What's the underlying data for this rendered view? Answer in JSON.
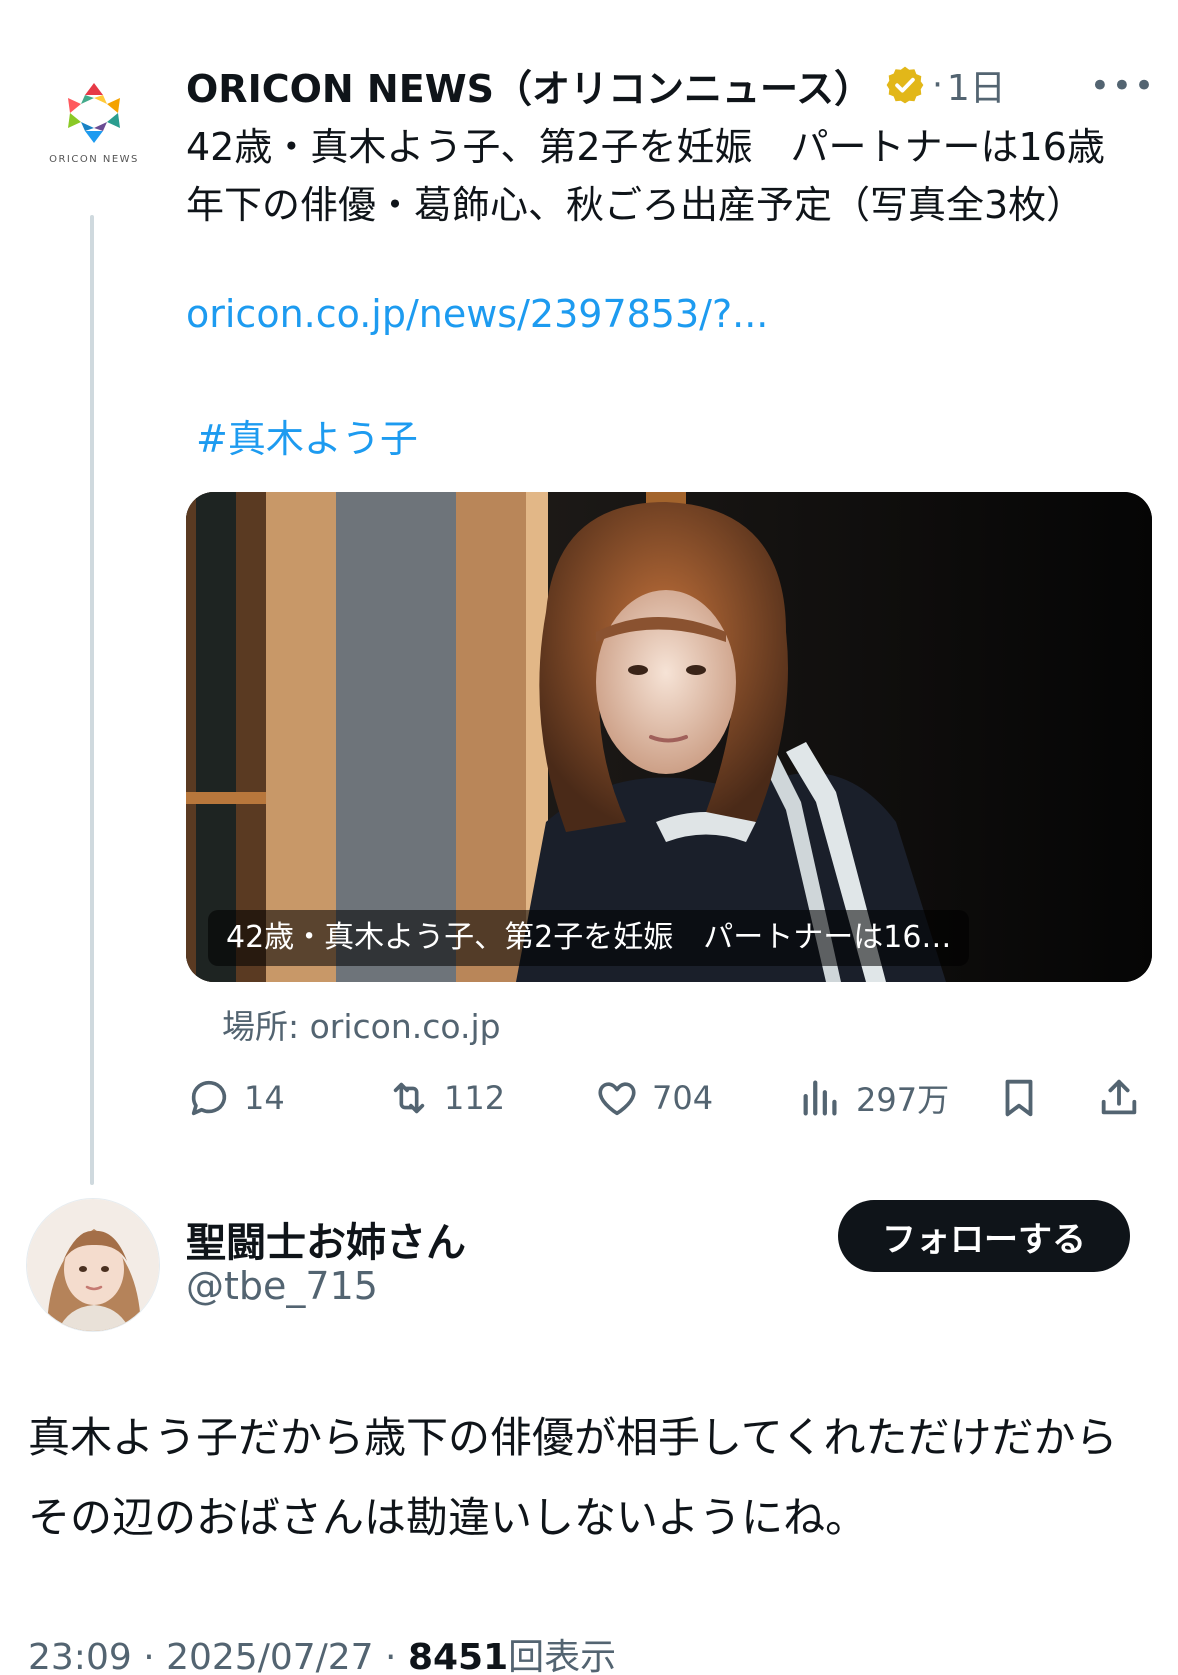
{
  "parent_tweet": {
    "avatar_caption": "ORICON NEWS",
    "display_name": "ORICON NEWS（オリコンニュース）",
    "time_ago": "1日",
    "text": "42歳・真木よう子、第2子を妊娠　パートナーは16歳年下の俳優・葛飾心、秋ごろ出産予定（写真全3枚）",
    "link": "oricon.co.jp/news/2397853/?...",
    "hashtag": "#真木よう子",
    "card": {
      "caption": "42歳・真木よう子、第2子を妊娠　パートナーは16…",
      "source": "場所: oricon.co.jp"
    },
    "actions": {
      "replies": "14",
      "retweets": "112",
      "likes": "704",
      "views": "297万"
    }
  },
  "reply_tweet": {
    "display_name": "聖闘士お姉さん",
    "handle": "@tbe_715",
    "follow_label": "フォローする",
    "text": "真木よう子だから歳下の俳優が相手してくれただけだからその辺のおばさんは勘違いしないようにね。",
    "time": "23:09",
    "date": "2025/07/27",
    "views_count": "8451",
    "views_label": "回表示"
  },
  "colors": {
    "link": "#1d9bf0",
    "secondary_text": "#536471",
    "primary_text": "#0f1419",
    "verified_badge": "#e2b719",
    "follow_button": "#0f1419"
  },
  "icons": {
    "verified": "verified-badge-icon",
    "more": "more-dots-icon",
    "reply": "reply-bubble-icon",
    "retweet": "retweet-arrows-icon",
    "like": "heart-icon",
    "views": "bar-chart-icon",
    "bookmark": "bookmark-icon",
    "share": "share-upload-icon"
  }
}
